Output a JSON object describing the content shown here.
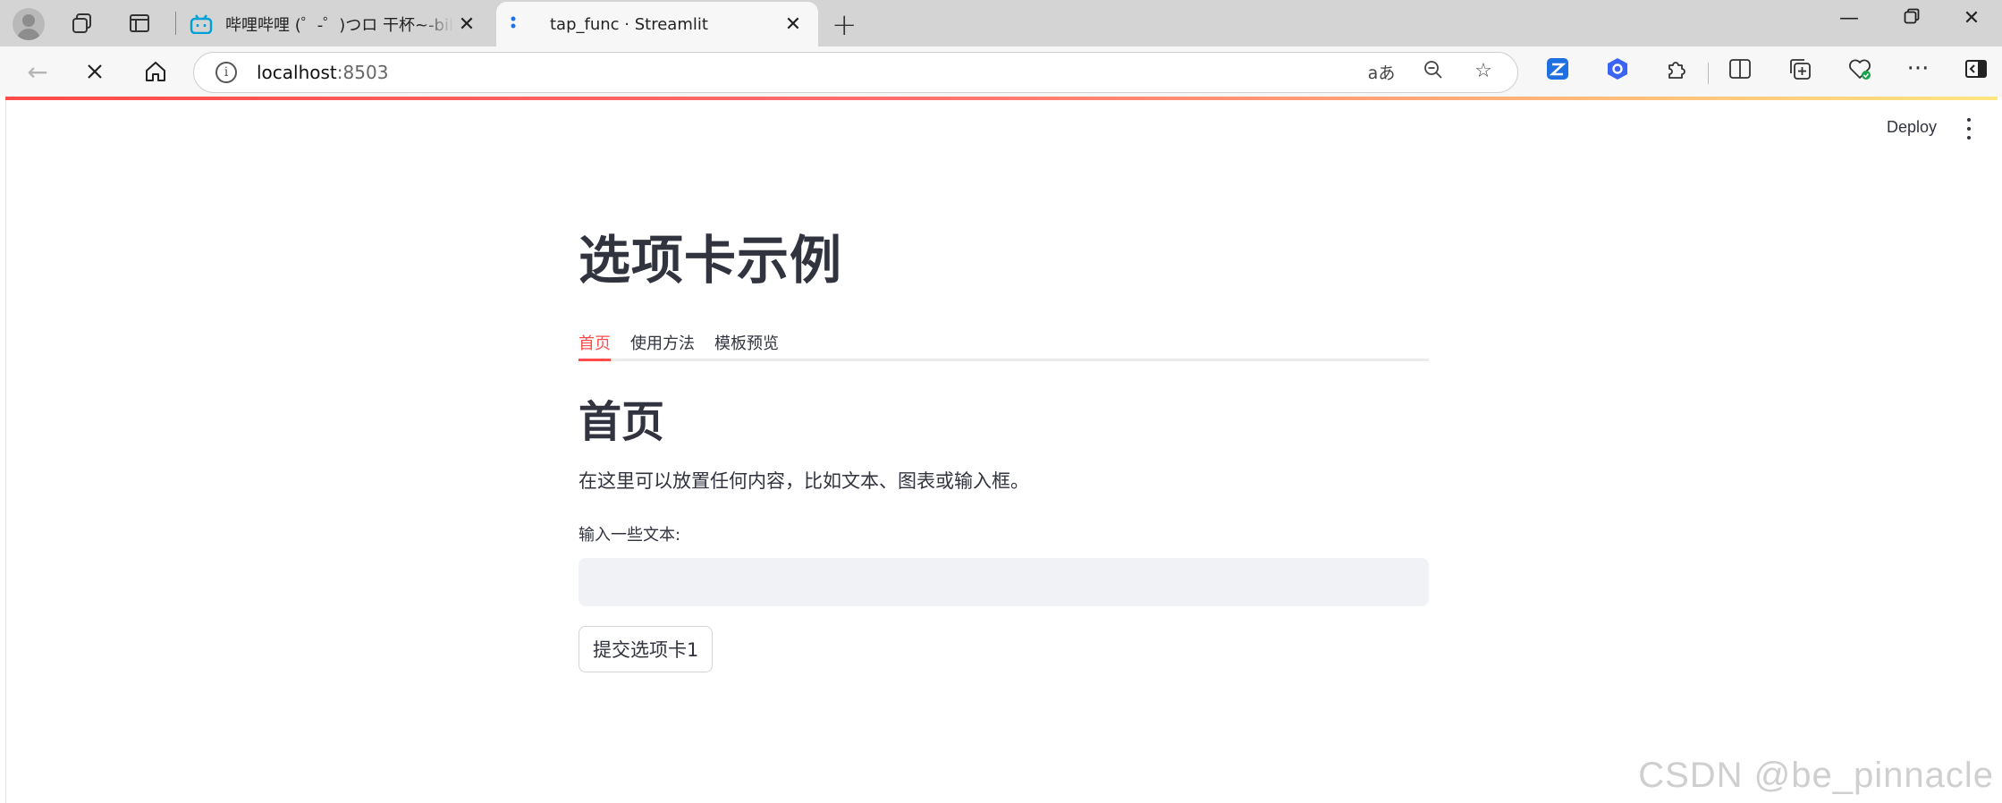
{
  "browser": {
    "tabs": [
      {
        "title": "哔哩哔哩 (゜-゜)つロ 干杯~-bilibili",
        "active": false
      },
      {
        "title": "tap_func · Streamlit",
        "active": true
      }
    ],
    "address": {
      "host": "localhost",
      "port": ":8503"
    },
    "icons": {
      "profile": "profile-avatar",
      "workspaces": "workspaces-icon",
      "tab_actions": "tab-actions-icon",
      "back": "back-arrow-icon",
      "stop": "stop-loading-icon",
      "home": "home-icon",
      "info": "site-info-icon",
      "read_aloud": "read-aloud-icon",
      "zoom": "zoom-out-icon",
      "favorite": "favorite-star-icon",
      "extensions": "extensions-icon",
      "split": "split-screen-icon",
      "collections": "collections-icon",
      "health": "browser-essentials-icon",
      "more": "more-icon",
      "sidebar": "sidebar-icon"
    }
  },
  "app": {
    "deploy_label": "Deploy",
    "title": "选项卡示例",
    "tabs": [
      "首页",
      "使用方法",
      "模板预览"
    ],
    "selected_tab": 0,
    "section_heading": "首页",
    "description": "在这里可以放置任何内容，比如文本、图表或输入框。",
    "input_label": "输入一些文本:",
    "input_value": "",
    "submit_label": "提交选项卡1",
    "accent_color": "#ff4b4b"
  },
  "watermark": "CSDN @be_pinnacle"
}
